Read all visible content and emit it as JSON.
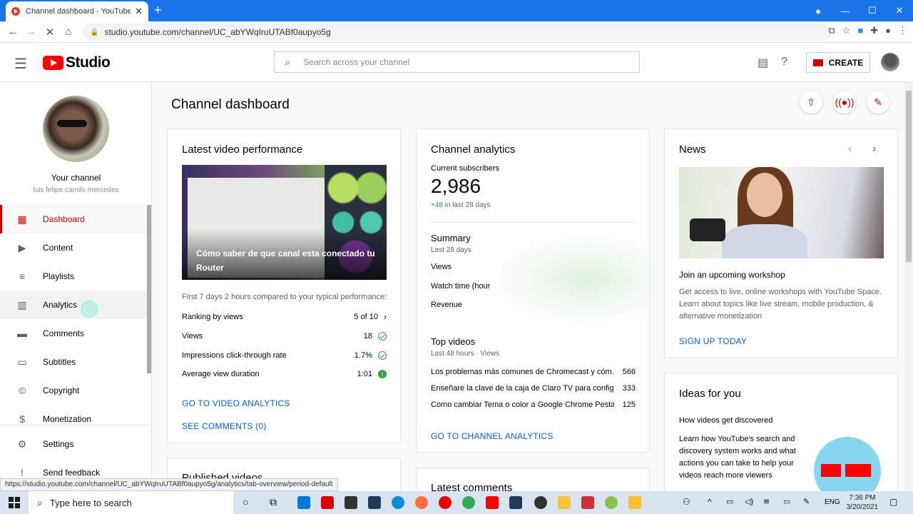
{
  "browser": {
    "tab_title": "Channel dashboard - YouTube St",
    "tab_close": "✕",
    "new_tab": "+",
    "url": "studio.youtube.com/channel/UC_abYWqIruUTABf0aupyo5g",
    "status_url": "https://studio.youtube.com/channel/UC_abYWqIruUTABf0aupyo5g/analytics/tab-overview/period-default",
    "nav": {
      "back": "←",
      "forward": "→",
      "reload": "✕",
      "home": "⌂"
    },
    "window": {
      "minimize": "—",
      "maximize": "☐",
      "close": "✕"
    }
  },
  "header": {
    "logo_text": "Studio",
    "search_placeholder": "Search across your channel",
    "create_label": "CREATE"
  },
  "sidebar": {
    "channel_label": "Your channel",
    "channel_name": "luis felipe camilo mercedes",
    "items": [
      {
        "label": "Dashboard",
        "icon": "dashboard-icon"
      },
      {
        "label": "Content",
        "icon": "content-icon"
      },
      {
        "label": "Playlists",
        "icon": "playlists-icon"
      },
      {
        "label": "Analytics",
        "icon": "analytics-icon"
      },
      {
        "label": "Comments",
        "icon": "comments-icon"
      },
      {
        "label": "Subtitles",
        "icon": "subtitles-icon"
      },
      {
        "label": "Copyright",
        "icon": "copyright-icon"
      },
      {
        "label": "Monetization",
        "icon": "monetization-icon"
      },
      {
        "label": "Settings",
        "icon": "settings-icon"
      },
      {
        "label": "Send feedback",
        "icon": "feedback-icon"
      }
    ]
  },
  "main": {
    "title": "Channel dashboard",
    "latest_video": {
      "title": "Latest video performance",
      "video_title": "Cómo saber de que canal esta conectado tu Router",
      "caption": "First 7 days 2 hours compared to your typical performance:",
      "rows": [
        {
          "label": "Ranking by views",
          "value": "5 of 10"
        },
        {
          "label": "Views",
          "value": "18"
        },
        {
          "label": "Impressions click-through rate",
          "value": "1.7%"
        },
        {
          "label": "Average view duration",
          "value": "1:01"
        }
      ],
      "link_analytics": "GO TO VIDEO ANALYTICS",
      "link_comments": "SEE COMMENTS (0)"
    },
    "published_videos_title": "Published videos",
    "analytics": {
      "title": "Channel analytics",
      "subs_label": "Current subscribers",
      "subs_value": "2,986",
      "subs_change": "+48",
      "subs_change_suffix": "in last 28 days",
      "summary_title": "Summary",
      "summary_period": "Last 28 days",
      "summary_rows": [
        "Views",
        "Watch time (hour",
        "Revenue"
      ],
      "top_title": "Top videos",
      "top_period": "Last 48 hours · Views",
      "top_videos": [
        {
          "title": "Los problemas más comunes de Chromecast y cóm...",
          "views": "566"
        },
        {
          "title": "Enseñare la clave de la caja de Claro TV para configu...",
          "views": "333"
        },
        {
          "title": "Como cambiar Tema o color a Google Chrome Pesta...",
          "views": "125"
        }
      ],
      "link": "GO TO CHANNEL ANALYTICS"
    },
    "latest_comments_title": "Latest comments",
    "news": {
      "title": "News",
      "headline": "Join an upcoming workshop",
      "body": "Get access to live, online workshops with YouTube Space. Learn about topics like live stream, mobile production, & alternative monetization",
      "link": "SIGN UP TODAY"
    },
    "ideas": {
      "title": "Ideas for you",
      "subtitle": "How videos get discovered",
      "body": "Learn how YouTube's search and discovery system works and what actions you can take to help your videos reach more viewers"
    }
  },
  "taskbar": {
    "search_placeholder": "Type here to search",
    "lang": "ENG",
    "time": "7:36 PM",
    "date": "3/20/2021"
  },
  "colors": {
    "accent": "#cc0000",
    "link": "#065fd4",
    "chrome_blue": "#1a73e8",
    "success": "#2ba640"
  }
}
